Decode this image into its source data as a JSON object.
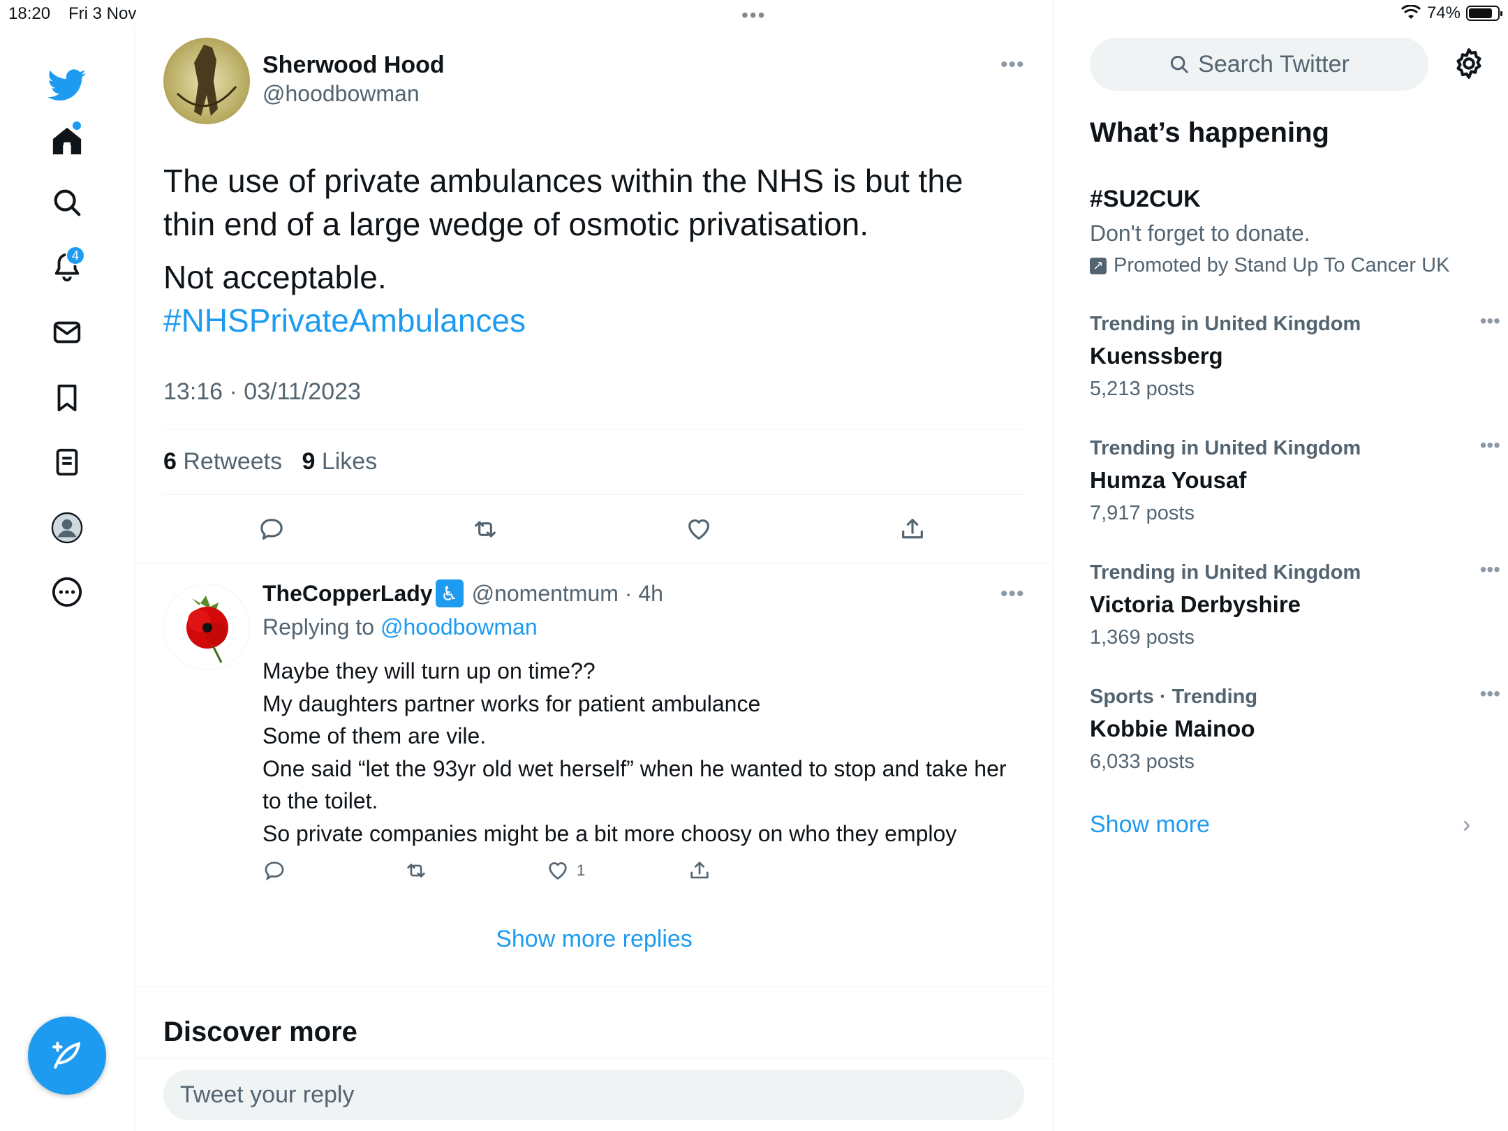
{
  "status_bar": {
    "time": "18:20",
    "date": "Fri 3 Nov",
    "battery": "74%"
  },
  "nav": {
    "notifications_badge": "4"
  },
  "tweet": {
    "author_name": "Sherwood Hood",
    "author_handle": "@hoodbowman",
    "text": "The use of private ambulances within the NHS is but the thin end of a large wedge of osmotic privatisation.",
    "text2": "Not acceptable.",
    "hashtag": "#NHSPrivateAmbulances",
    "timestamp": "13:16 · 03/11/2023",
    "retweets_count": "6",
    "retweets_label": "Retweets",
    "likes_count": "9",
    "likes_label": "Likes"
  },
  "reply": {
    "name": "TheCopperLady",
    "handle": "@nomentmum · 4h",
    "replying_prefix": "Replying to",
    "replying_to": "@hoodbowman",
    "lines": [
      "Maybe they will turn up on time??",
      "My daughters partner works for patient ambulance",
      "Some of them are vile.",
      "One said “let the 93yr old wet herself” when he wanted to stop and take her to the toilet.",
      "So private companies might be a bit more choosy on who they employ"
    ],
    "like_count": "1"
  },
  "show_more_replies": "Show more replies",
  "discover_more": "Discover more",
  "reply_box": {
    "placeholder": "Tweet your reply"
  },
  "sidebar": {
    "search_placeholder": "Search Twitter",
    "whats_happening": "What’s happening",
    "promoted": {
      "tag": "#SU2CUK",
      "description": "Don't forget to donate.",
      "by": "Promoted by Stand Up To Cancer UK"
    },
    "trends": [
      {
        "context": "Trending in United Kingdom",
        "name": "Kuenssberg",
        "count": "5,213 posts"
      },
      {
        "context": "Trending in United Kingdom",
        "name": "Humza Yousaf",
        "count": "7,917 posts"
      },
      {
        "context": "Trending in United Kingdom",
        "name": "Victoria Derbyshire",
        "count": "1,369 posts"
      },
      {
        "context": "Sports · Trending",
        "name": "Kobbie Mainoo",
        "count": "6,033 posts"
      }
    ],
    "show_more": "Show more"
  },
  "colors": {
    "accent": "#1d9bf0",
    "secondary_text": "#536471",
    "primary_text": "#0f1419"
  }
}
